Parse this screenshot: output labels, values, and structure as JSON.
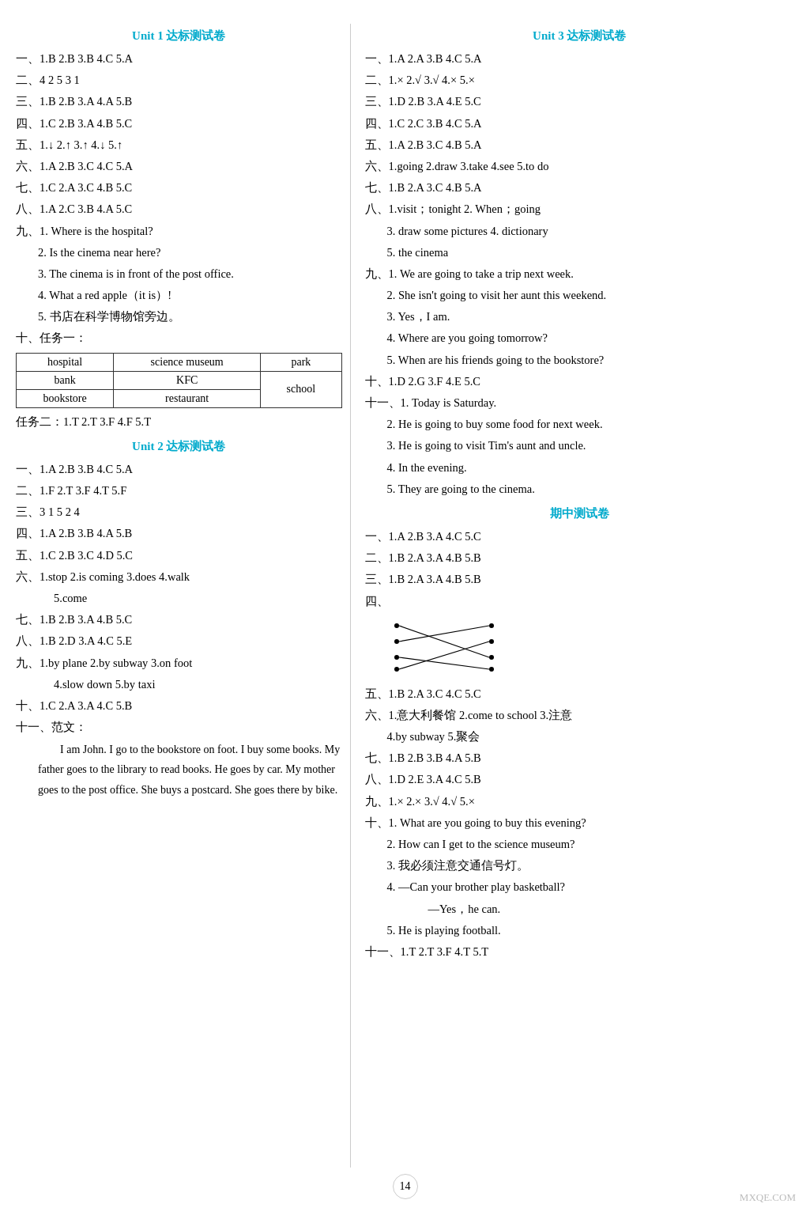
{
  "left": {
    "unit1_title": "Unit 1 达标测试卷",
    "unit1_lines": [
      "一、1.B  2.B  3.B  4.C  5.A",
      "二、4  2  5  3  1",
      "三、1.B  2.B  3.A  4.A  5.B",
      "四、1.C  2.B  3.A  4.B  5.C",
      "五、1.↓  2.↑  3.↑  4.↓  5.↑",
      "六、1.A  2.B  3.C  4.C  5.A",
      "七、1.C  2.A  3.C  4.B  5.C",
      "八、1.A  2.C  3.B  4.A  5.C",
      "九、1. Where is the hospital?",
      "2. Is the cinema near here?",
      "3. The cinema is in front of the post office.",
      "4. What a red apple（it is）!",
      "5. 书店在科学博物馆旁边。",
      "十、任务一："
    ],
    "table": {
      "row1": [
        "hospital",
        "science museum",
        "park"
      ],
      "row2_col1": "bank",
      "row2_col2": "KFC",
      "row2_col3": "school",
      "row3_col1": "bookstore",
      "row3_col2": "restaurant"
    },
    "unit1_after_table": "任务二：1.T  2.T  3.F  4.F  5.T",
    "unit2_title": "Unit 2 达标测试卷",
    "unit2_lines": [
      "一、1.A  2.B  3.B  4.C  5.A",
      "二、1.F  2.T  3.F  4.T  5.F",
      "三、3  1  5  2  4",
      "四、1.A  2.B  3.B  4.A  5.B",
      "五、1.C  2.B  3.C  4.D  5.C",
      "六、1.stop  2.is coming  3.does  4.walk",
      "    5.come",
      "七、1.B  2.B  3.A  4.B  5.C",
      "八、1.B  2.D  3.A  4.C  5.E",
      "九、1.by plane  2.by subway  3.on foot",
      "    4.slow down  5.by taxi",
      "十、1.C  2.A  3.A  4.C  5.B",
      "十一、范文："
    ],
    "essay": "I am John. I go to the bookstore on foot. I buy some books. My father goes to the library to read books. He goes by car. My mother goes to the post office. She buys a postcard. She goes there by bike."
  },
  "right": {
    "unit3_title": "Unit 3 达标测试卷",
    "unit3_lines": [
      "一、1.A  2.A  3.B  4.C  5.A",
      "二、1.×  2.√  3.√  4.×  5.×",
      "三、1.D  2.B  3.A  4.E  5.C",
      "四、1.C  2.C  3.B  4.C  5.A",
      "五、1.A  2.B  3.C  4.B  5.A",
      "六、1.going  2.draw  3.take  4.see  5.to do",
      "七、1.B  2.A  3.C  4.B  5.A",
      "八、1.visit；tonight  2. When；going",
      "    3. draw some pictures  4. dictionary",
      "    5. the cinema",
      "九、1. We are going to take a trip next week.",
      "    2. She isn't going to visit her aunt this weekend.",
      "    3. Yes，I am.",
      "    4. Where are you going tomorrow?",
      "    5. When are his friends going to the bookstore?",
      "十、1.D  2.G  3.F  4.E  5.C",
      "十一、1. Today is Saturday.",
      "    2. He is going to buy some food for next week.",
      "    3. He is going to visit Tim's aunt and uncle.",
      "    4. In the evening.",
      "    5. They are going to the cinema."
    ],
    "mid_title": "期中测试卷",
    "mid_lines": [
      "一、1.A  2.B  3.A  4.C  5.C",
      "二、1.B  2.A  3.A  4.B  5.B",
      "三、1.B  2.A  3.A  4.B  5.B",
      "四、"
    ],
    "mid_lines2": [
      "五、1.B  2.A  3.C  4.C  5.C",
      "六、1.意大利餐馆  2.come to school  3.注意",
      "    4.by subway  5.聚会",
      "七、1.B  2.B  3.B  4.A  5.B",
      "八、1.D  2.E  3.A  4.C  5.B",
      "九、1.×  2.×  3.√  4.√  5.×",
      "十、1. What are you going to buy this evening?",
      "    2. How can I get to the science museum?",
      "    3. 我必须注意交通信号灯。",
      "    4. —Can your brother play basketball?",
      "        —Yes，he can.",
      "    5. He is playing football.",
      "十一、1.T  2.T  3.F  4.T  5.T"
    ],
    "page_num": "14",
    "watermark": "MXQE.COM"
  }
}
